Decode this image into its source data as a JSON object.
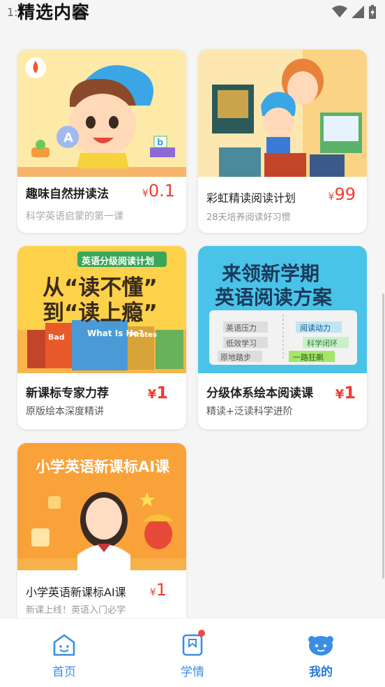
{
  "status_bar": {
    "time": "1:"
  },
  "header": {
    "title": "精选内容"
  },
  "cards": [
    {
      "title": "趣味自然拼读法",
      "subtitle": "科学英语启蒙的第一课",
      "price_currency": "¥",
      "price_value": "0.1"
    },
    {
      "title": "彩虹精读阅读计划",
      "subtitle": "28天培养阅读好习惯",
      "price_currency": "¥",
      "price_value": "99"
    },
    {
      "title": "新课标专家力荐",
      "subtitle": "原版绘本深度精讲",
      "price_currency": "¥",
      "price_value": "1",
      "banner": {
        "tag": "英语分级阅读计划",
        "line1": "从“读不懂”",
        "line2": "到“读上瘾”",
        "books": [
          "Bad",
          "What Is He?",
          "Pirates"
        ]
      }
    },
    {
      "title": "分级体系绘本阅读课",
      "subtitle": "精读+泛读科学进阶",
      "price_currency": "¥",
      "price_value": "1",
      "banner": {
        "line1": "来领新学期",
        "line2": "英语阅读方案",
        "left": [
          "英语压力",
          "低效学习",
          "原地踏步"
        ],
        "right": [
          "阅读动力",
          "科学闭环",
          "一路狂飙"
        ]
      }
    },
    {
      "title": "小学英语新课标AI课",
      "subtitle": "新课上线！英语入门必学",
      "price_currency": "¥",
      "price_value": "1",
      "banner": {
        "headline": "小学英语新课标AI课"
      }
    }
  ],
  "tabbar": {
    "items": [
      {
        "label": "首页",
        "icon": "home-face-icon"
      },
      {
        "label": "学情",
        "icon": "bookmark-book-icon",
        "badge": true
      },
      {
        "label": "我的",
        "icon": "profile-face-icon",
        "active": true
      }
    ]
  },
  "colors": {
    "accent": "#3a8ee6",
    "price": "#f03c2e",
    "badge": "#f04848"
  }
}
